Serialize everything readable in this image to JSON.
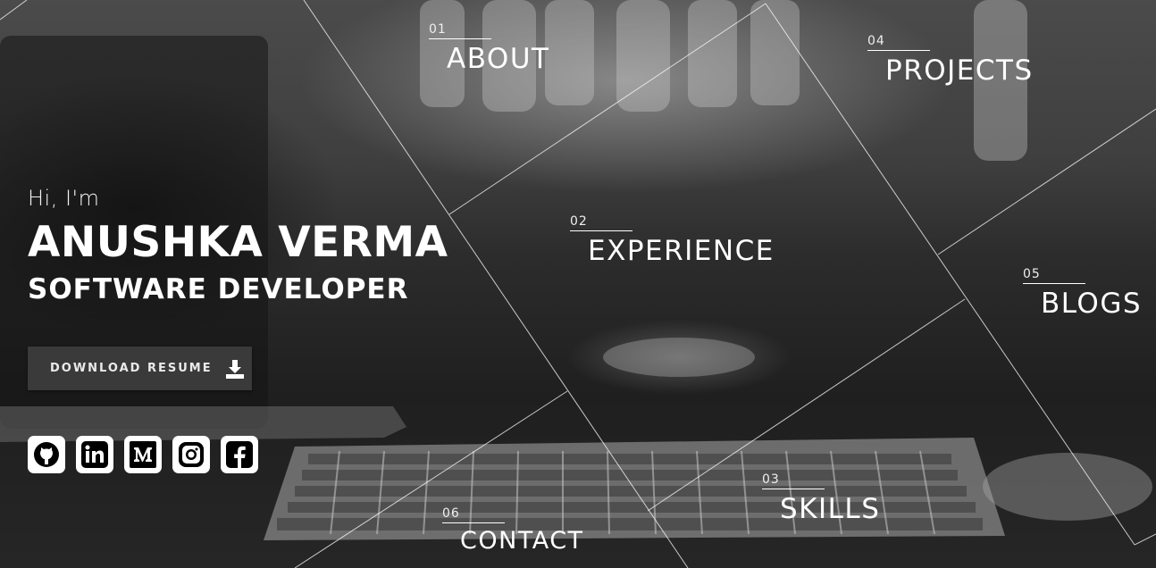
{
  "hero": {
    "greeting": "Hi, I'm",
    "name": "ANUSHKA VERMA",
    "role": "SOFTWARE DEVELOPER",
    "resume_button": "DOWNLOAD RESUME"
  },
  "socials": [
    {
      "name": "GitHub",
      "icon": "github-icon"
    },
    {
      "name": "LinkedIn",
      "icon": "linkedin-icon"
    },
    {
      "name": "Medium",
      "icon": "medium-icon"
    },
    {
      "name": "Instagram",
      "icon": "instagram-icon"
    },
    {
      "name": "Facebook",
      "icon": "facebook-icon"
    }
  ],
  "nav": {
    "about": {
      "number": "01",
      "label": "ABOUT"
    },
    "experience": {
      "number": "02",
      "label": "EXPERIENCE"
    },
    "skills": {
      "number": "03",
      "label": "SKILLS"
    },
    "projects": {
      "number": "04",
      "label": "PROJECTS"
    },
    "blogs": {
      "number": "05",
      "label": "BLOGS"
    },
    "contact": {
      "number": "06",
      "label": "CONTACT"
    }
  },
  "colors": {
    "text": "#ffffff",
    "button_bg": "#3a3a3a",
    "lines": "#ffffff"
  }
}
